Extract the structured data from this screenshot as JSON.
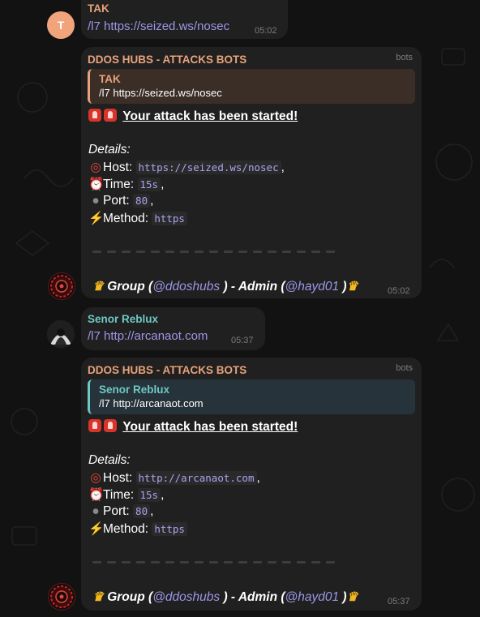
{
  "colors": {
    "background": "#121212",
    "bubble": "#202020",
    "sender_orange": "#e8a27a",
    "sender_teal": "#6fc8c4",
    "link": "#9d97e8",
    "code_text": "#a9a5f2",
    "timestamp": "#7b7b7b"
  },
  "messages": [
    {
      "type": "user",
      "sender": "TAK",
      "avatar_letter": "T",
      "avatar_color": "#f1a37c",
      "text_cmd": "/l7",
      "text_url": "https://seized.ws/nosec",
      "time": "05:02"
    },
    {
      "type": "bot",
      "sender": "DDOS HUBS - ATTACKS BOTS",
      "tag": "bots",
      "quote_name": "TAK",
      "quote_text": "/l7 https://seized.ws/nosec",
      "started": "Your attack has been started!",
      "details_label": "Details:",
      "host_label": "Host:",
      "host_value": "https://seized.ws/nosec",
      "time_label": "Time:",
      "time_value": "15s",
      "port_label": "Port:",
      "port_value": "80",
      "method_label": "Method:",
      "method_value": "https",
      "footer_group": "Group (",
      "footer_group_handle": "@ddoshubs",
      "footer_admin": ") - Admin (",
      "footer_admin_handle": "@hayd01",
      "footer_close": ")",
      "time": "05:02",
      "icons": [
        "siren-icon",
        "target-icon",
        "alarm-clock-icon",
        "bomb-icon",
        "lightning-icon",
        "crown-icon"
      ]
    },
    {
      "type": "user",
      "sender": "Senor Reblux",
      "text_cmd": "/l7",
      "text_url": "http://arcanaot.com",
      "time": "05:37"
    },
    {
      "type": "bot",
      "sender": "DDOS HUBS - ATTACKS BOTS",
      "tag": "bots",
      "quote_name": "Senor Reblux",
      "quote_text": "/l7 http://arcanaot.com",
      "started": "Your attack has been started!",
      "details_label": "Details:",
      "host_label": "Host:",
      "host_value": "http://arcanaot.com",
      "time_label": "Time:",
      "time_value": "15s",
      "port_label": "Port:",
      "port_value": "80",
      "method_label": "Method:",
      "method_value": "https",
      "footer_group": "Group (",
      "footer_group_handle": "@ddoshubs",
      "footer_admin": ") - Admin (",
      "footer_admin_handle": "@hayd01",
      "footer_close": ")",
      "time": "05:37",
      "icons": [
        "siren-icon",
        "target-icon",
        "alarm-clock-icon",
        "bomb-icon",
        "lightning-icon",
        "crown-icon"
      ]
    }
  ]
}
